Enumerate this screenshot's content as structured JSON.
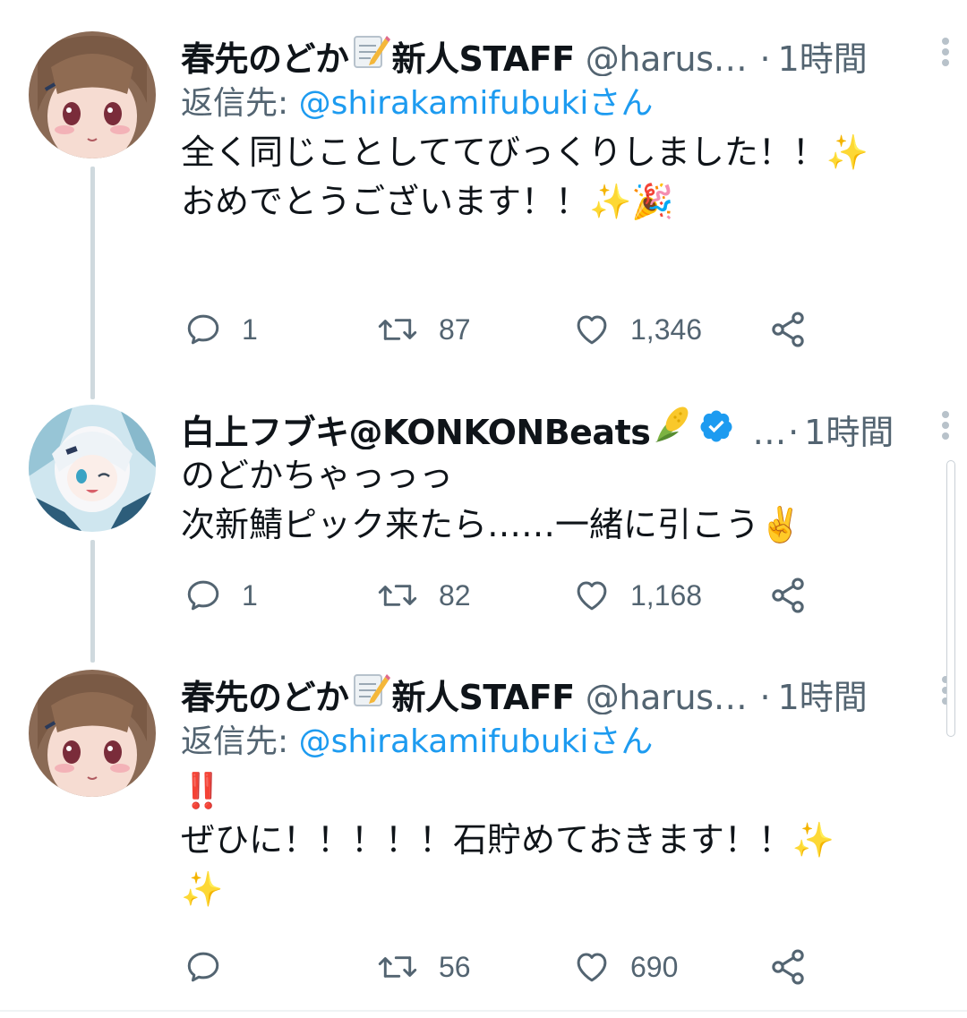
{
  "colors": {
    "text": "#0f1419",
    "secondary": "#536471",
    "accent": "#1d9bf0",
    "thread_line": "#cfd9de"
  },
  "tweets": [
    {
      "display_name": "春先のどか",
      "name_emoji": "memo-emoji",
      "display_name_suffix": "新人STAFF",
      "handle": "@harus…",
      "dot": "·",
      "time": "1時間",
      "reply_label": "返信先: ",
      "reply_mention": "@shirakamifubukiさん",
      "body": "全く同じことしててびっくりしました！！✨\nおめでとうございます！！✨🎉",
      "replies": "1",
      "retweets": "87",
      "likes": "1,346"
    },
    {
      "display_name": "白上フブキ@KONKONBeats",
      "name_emoji": "corn-emoji",
      "verified": true,
      "handle": "…",
      "dot": "·",
      "time": "1時間",
      "body": "のどかちゃっっっ\n次新鯖ピック来たら……一緒に引こう✌️",
      "replies": "1",
      "retweets": "82",
      "likes": "1,168"
    },
    {
      "display_name": "春先のどか",
      "name_emoji": "memo-emoji",
      "display_name_suffix": "新人STAFF",
      "handle": "@harus…",
      "dot": "·",
      "time": "1時間",
      "reply_label": "返信先: ",
      "reply_mention": "@shirakamifubukiさん",
      "body": "‼️\nぜひに！！！！！石貯めておきます！！✨\n✨",
      "replies": "",
      "retweets": "56",
      "likes": "690"
    }
  ]
}
